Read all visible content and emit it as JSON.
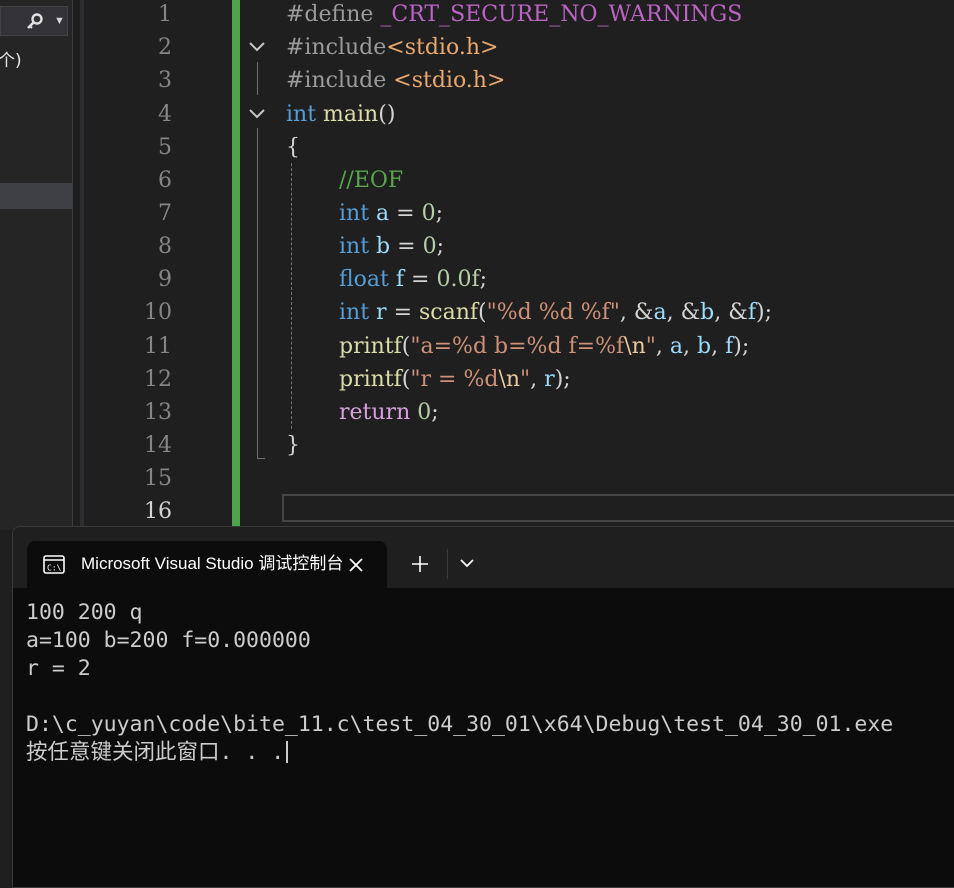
{
  "left_panel": {
    "search_icon": "search-key-icon",
    "count_text": "个)"
  },
  "editor": {
    "line_numbers": [
      "1",
      "2",
      "3",
      "4",
      "5",
      "6",
      "7",
      "8",
      "9",
      "10",
      "11",
      "12",
      "13",
      "14",
      "15",
      "16"
    ],
    "current_line": "16",
    "change_bar_color": "#4ea34b",
    "code": {
      "l1_directive": "#define ",
      "l1_macro": "_CRT_SECURE_NO_WARNINGS",
      "l2_directive": "#include",
      "l2_header": "<stdio.h>",
      "l3_directive": "#include ",
      "l3_header": "<stdio.h>",
      "l4_type": "int",
      "l4_name": "main",
      "l4_parens": "()",
      "l5_brace": "{",
      "l6_comment": "//EOF",
      "l7_type": "int",
      "l7_var": "a",
      "l7_eq": " = ",
      "l7_val": "0",
      "l7_end": ";",
      "l8_type": "int",
      "l8_var": "b",
      "l8_eq": " = ",
      "l8_val": "0",
      "l8_end": ";",
      "l9_type": "float",
      "l9_var": "f",
      "l9_eq": " = ",
      "l9_val": "0.0f",
      "l9_end": ";",
      "l10_type": "int",
      "l10_var": "r",
      "l10_eq": " = ",
      "l10_fn": "scanf",
      "l10_open": "(",
      "l10_str": "\"%d %d %f\"",
      "l10_sep1": ", &",
      "l10_a": "a",
      "l10_sep2": ", &",
      "l10_b": "b",
      "l10_sep3": ", &",
      "l10_f": "f",
      "l10_close": ");",
      "l11_fn": "printf",
      "l11_open": "(",
      "l11_str": "\"a=%d b=%d f=%f",
      "l11_esc": "\\n",
      "l11_strend": "\"",
      "l11_sep1": ", ",
      "l11_a": "a",
      "l11_sep2": ", ",
      "l11_b": "b",
      "l11_sep3": ", ",
      "l11_f": "f",
      "l11_close": ");",
      "l12_fn": "printf",
      "l12_open": "(",
      "l12_str": "\"r = %d",
      "l12_esc": "\\n",
      "l12_strend": "\"",
      "l12_sep": ", ",
      "l12_r": "r",
      "l12_close": ");",
      "l13_kw": "return",
      "l13_sp": " ",
      "l13_val": "0",
      "l13_end": ";",
      "l14_brace": "}"
    }
  },
  "console": {
    "tab_title": "Microsoft Visual Studio 调试控制台",
    "icons": {
      "terminal": "terminal-icon",
      "close": "close-icon",
      "new_tab": "plus-icon",
      "dropdown": "chevron-down-icon"
    },
    "lines": [
      "100 200 q",
      "a=100 b=200 f=0.000000",
      "r = 2",
      "",
      "D:\\c_yuyan\\code\\bite_11.c\\test_04_30_01\\x64\\Debug\\test_04_30_01.exe",
      "按任意键关闭此窗口. . ."
    ]
  }
}
